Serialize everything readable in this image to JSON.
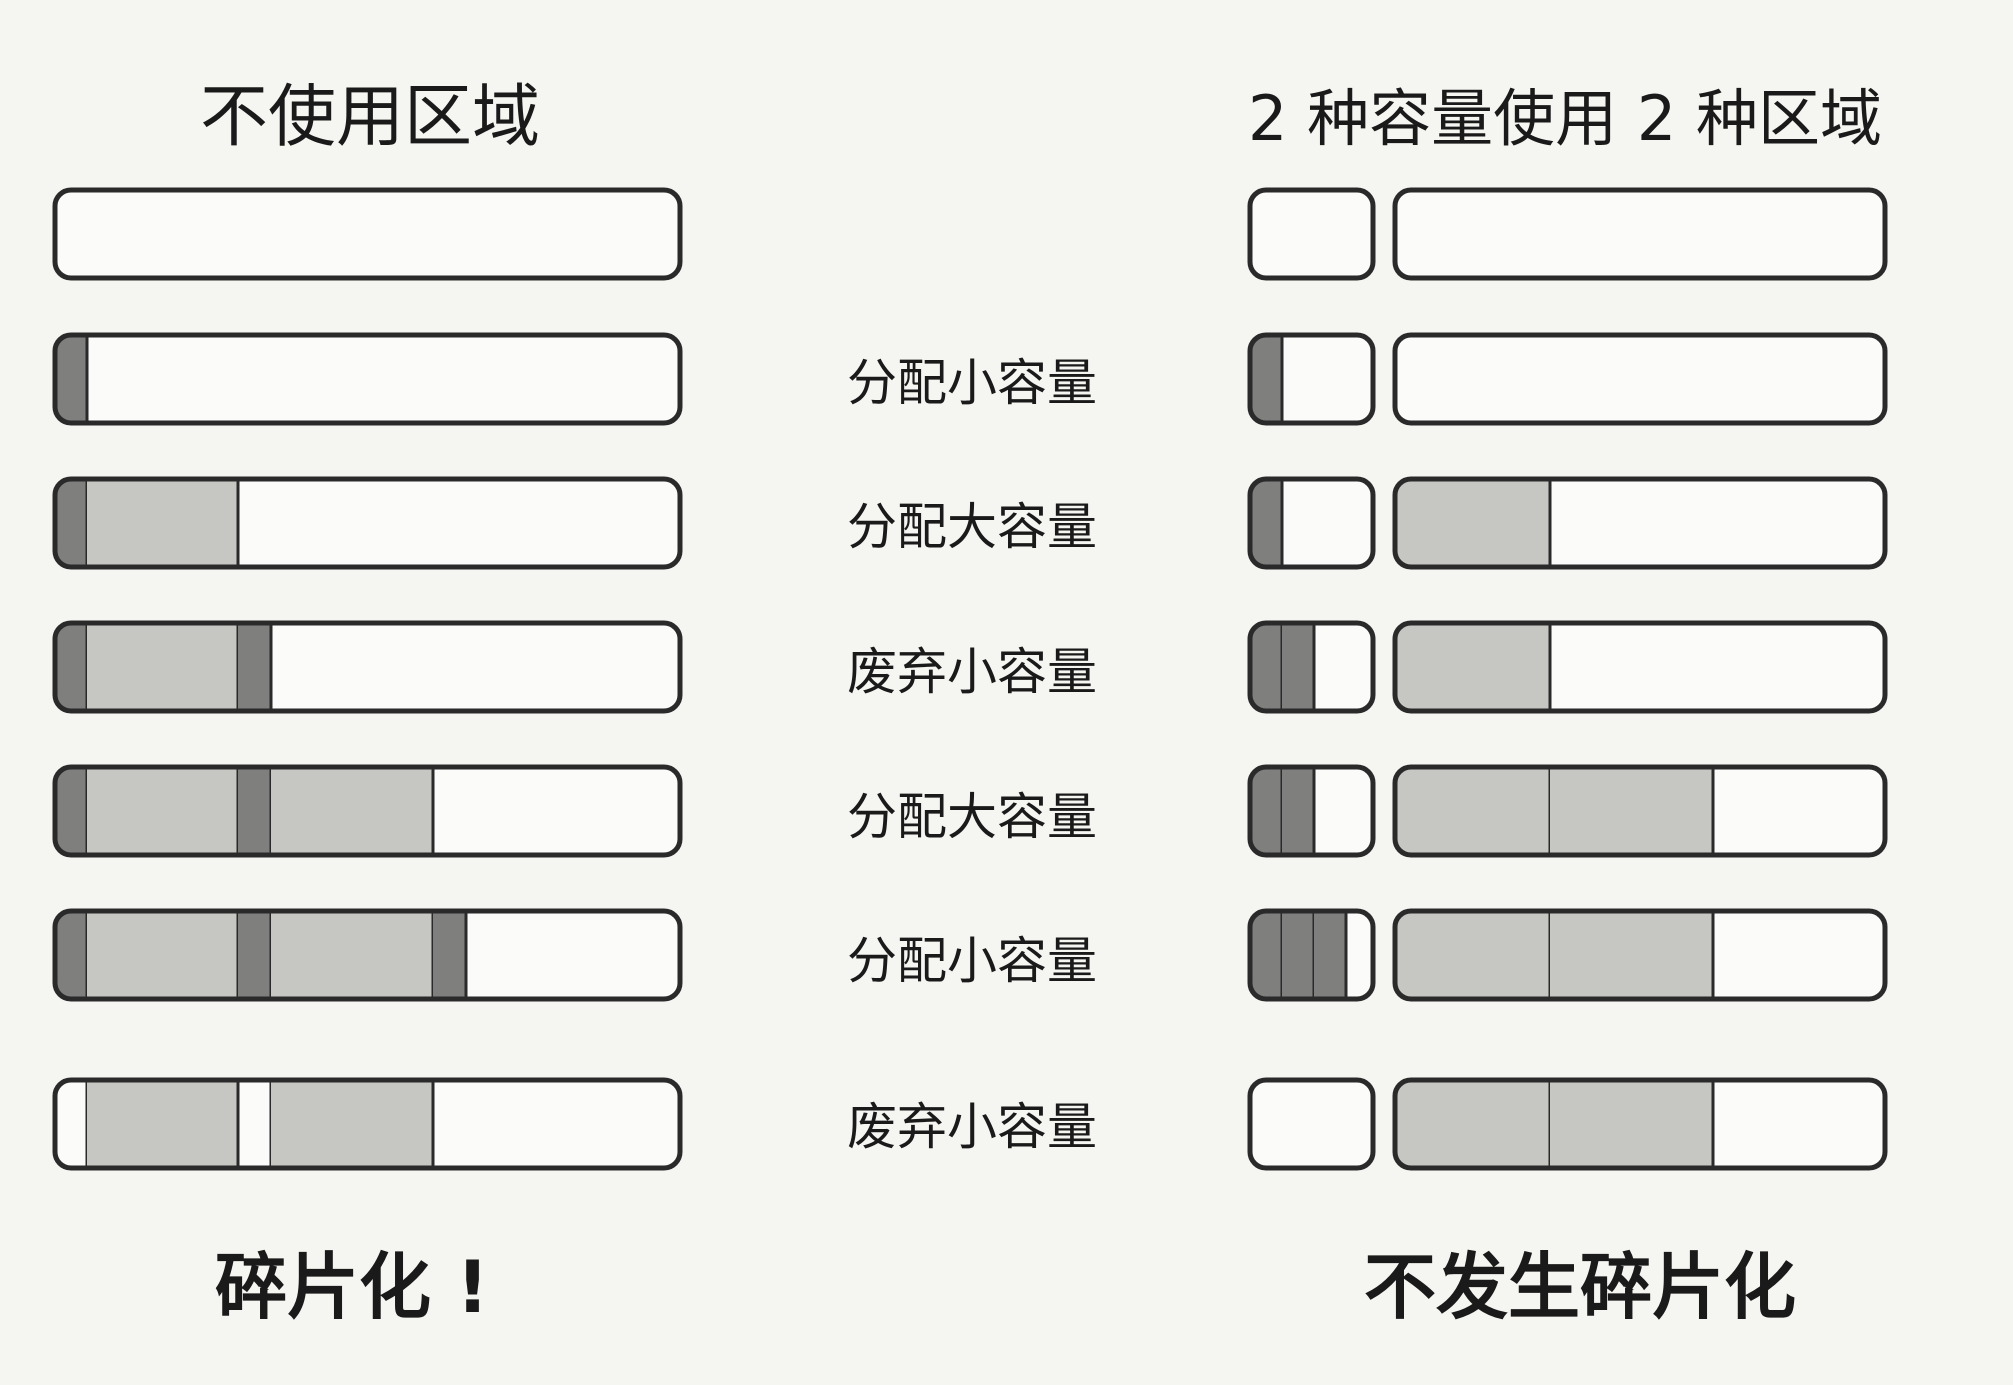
{
  "headings": {
    "left": "不使用区域",
    "right": "2 种容量使用 2 种区域"
  },
  "steps": [
    "分配小容量",
    "分配大容量",
    "废弃小容量",
    "分配大容量",
    "分配小容量",
    "废弃小容量"
  ],
  "results": {
    "left": "碎片化 !",
    "right": "不发生碎片化"
  },
  "colors": {
    "background": "#f5f5f2",
    "outline": "#2a2a2a",
    "empty": "#fbfbf9",
    "small_block": "#7f7f7d",
    "large_block": "#c6c6c3"
  }
}
